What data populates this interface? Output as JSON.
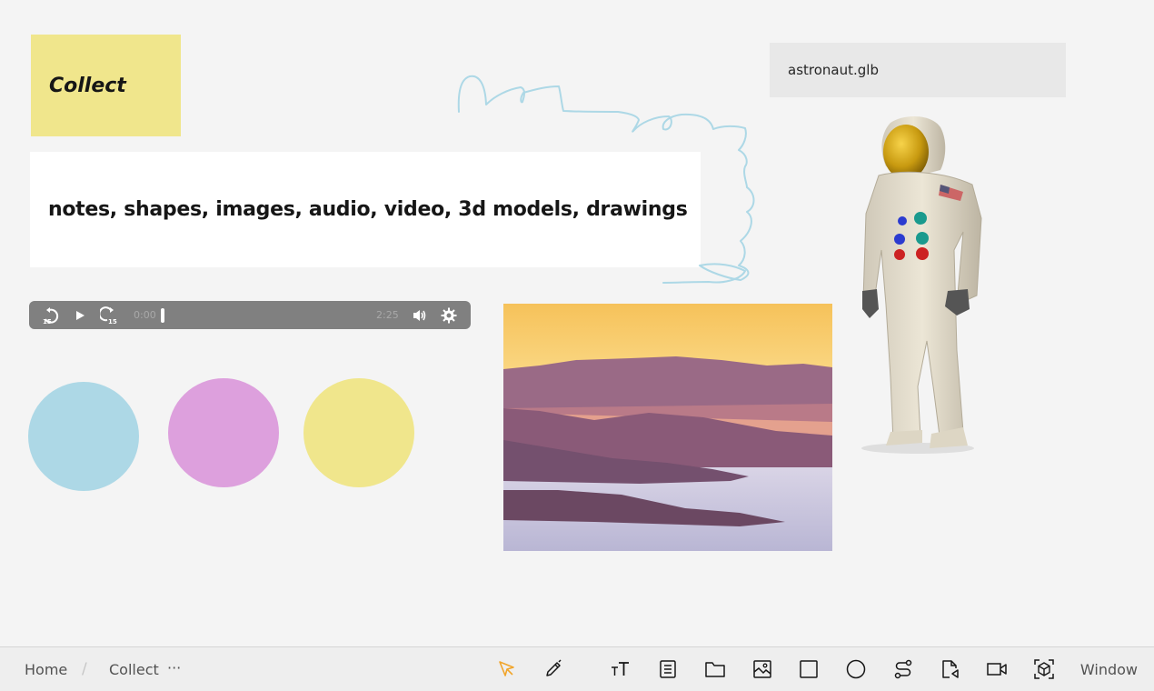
{
  "canvas": {
    "title_note": {
      "text": "Collect",
      "color": "#f0e68c"
    },
    "text_card": {
      "text": "notes, shapes, images, audio, video, 3d models, drawings"
    },
    "model_file": {
      "filename": "astronaut.glb"
    },
    "drawing": {
      "stroke_color": "#add8e6"
    },
    "audio": {
      "current_time": "0:00",
      "duration": "2:25",
      "progress": 0,
      "controls": [
        "rewind-15-icon",
        "play-icon",
        "forward-15-icon",
        "volume-icon",
        "settings-icon"
      ]
    },
    "shapes": [
      {
        "type": "circle",
        "color": "#add8e6"
      },
      {
        "type": "circle",
        "color": "#dda0dd"
      },
      {
        "type": "circle",
        "color": "#f0e68c"
      }
    ],
    "image": {
      "description": "misty mountain ridges at sunset"
    },
    "model": {
      "description": "astronaut 3d model"
    }
  },
  "bottom_bar": {
    "breadcrumb": [
      "Home",
      "Collect"
    ],
    "separator": "/",
    "more": "···",
    "tools": [
      {
        "name": "select-tool",
        "icon": "cursor-icon",
        "active": true
      },
      {
        "name": "draw-tool",
        "icon": "pen-icon"
      },
      {
        "name": "text-tool",
        "icon": "text-size-icon"
      },
      {
        "name": "note-tool",
        "icon": "document-icon"
      },
      {
        "name": "folder-tool",
        "icon": "folder-icon"
      },
      {
        "name": "image-tool",
        "icon": "image-icon"
      },
      {
        "name": "rectangle-tool",
        "icon": "square-icon"
      },
      {
        "name": "circle-tool",
        "icon": "circle-icon"
      },
      {
        "name": "connector-tool",
        "icon": "connector-icon"
      },
      {
        "name": "audio-tool",
        "icon": "audio-file-icon"
      },
      {
        "name": "video-tool",
        "icon": "video-icon"
      },
      {
        "name": "3d-model-tool",
        "icon": "cube-icon"
      }
    ],
    "active_color": "#f1a52b",
    "window_label": "Window"
  }
}
